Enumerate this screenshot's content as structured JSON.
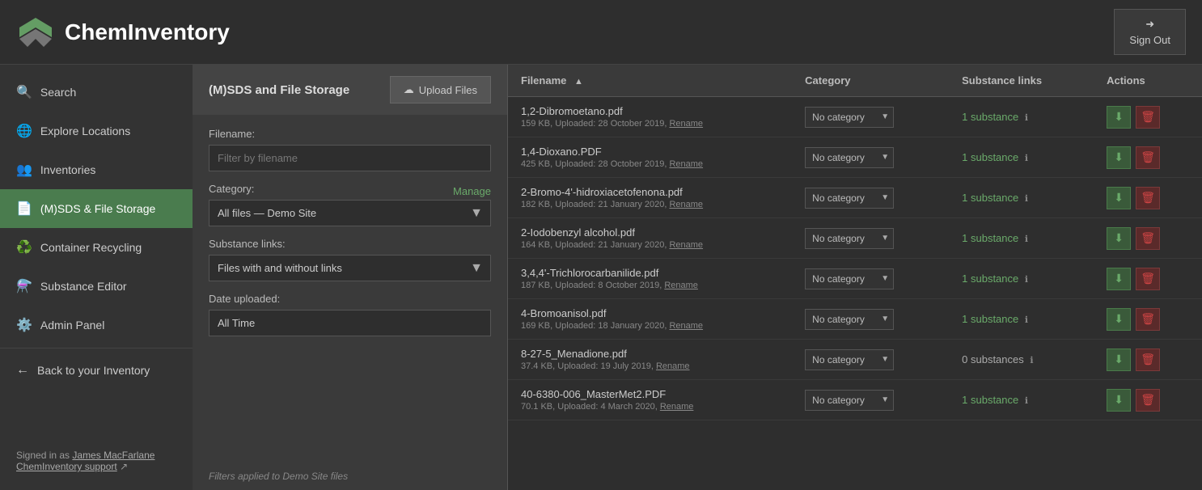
{
  "header": {
    "logo_text": "ChemInventory",
    "sign_out_label": "Sign Out"
  },
  "sidebar": {
    "items": [
      {
        "id": "search",
        "label": "Search",
        "icon": "🔍",
        "active": false
      },
      {
        "id": "explore-locations",
        "label": "Explore Locations",
        "icon": "🌐",
        "active": false
      },
      {
        "id": "inventories",
        "label": "Inventories",
        "icon": "👥",
        "active": false
      },
      {
        "id": "msds-file-storage",
        "label": "(M)SDS & File Storage",
        "icon": "📄",
        "active": true
      },
      {
        "id": "container-recycling",
        "label": "Container Recycling",
        "icon": "♻️",
        "active": false
      },
      {
        "id": "substance-editor",
        "label": "Substance Editor",
        "icon": "⚗️",
        "active": false
      },
      {
        "id": "admin-panel",
        "label": "Admin Panel",
        "icon": "⚙️",
        "active": false
      },
      {
        "id": "back-to-inventory",
        "label": "Back to your Inventory",
        "icon": "←",
        "active": false
      }
    ],
    "signed_in_as": "Signed in as",
    "user_name": "James MacFarlane",
    "support_link": "ChemInventory support"
  },
  "filter_panel": {
    "title": "(M)SDS and File Storage",
    "upload_button": "Upload Files",
    "filename_label": "Filename:",
    "filename_placeholder": "Filter by filename",
    "category_label": "Category:",
    "manage_label": "Manage",
    "category_value": "All files — Demo Site",
    "substance_links_label": "Substance links:",
    "substance_links_value": "Files with and without links",
    "date_uploaded_label": "Date uploaded:",
    "date_uploaded_value": "All Time",
    "footer_note": "Filters applied to Demo Site files"
  },
  "table": {
    "columns": [
      {
        "id": "filename",
        "label": "Filename",
        "sortable": true
      },
      {
        "id": "category",
        "label": "Category",
        "sortable": false
      },
      {
        "id": "substance-links",
        "label": "Substance links",
        "sortable": false
      },
      {
        "id": "actions",
        "label": "Actions",
        "sortable": false
      }
    ],
    "rows": [
      {
        "filename": "1,2-Dibromoetano.pdf",
        "meta": "159 KB, Uploaded: 28 October 2019,",
        "rename": "Rename",
        "category": "No category",
        "substance_count": 1,
        "substance_label": "1 substance",
        "zero": false
      },
      {
        "filename": "1,4-Dioxano.PDF",
        "meta": "425 KB, Uploaded: 28 October 2019,",
        "rename": "Rename",
        "category": "No category",
        "substance_count": 1,
        "substance_label": "1 substance",
        "zero": false
      },
      {
        "filename": "2-Bromo-4'-hidroxiacetofenona.pdf",
        "meta": "182 KB, Uploaded: 21 January 2020,",
        "rename": "Rename",
        "category": "No category",
        "substance_count": 1,
        "substance_label": "1 substance",
        "zero": false
      },
      {
        "filename": "2-Iodobenzyl alcohol.pdf",
        "meta": "164 KB, Uploaded: 21 January 2020,",
        "rename": "Rename",
        "category": "No category",
        "substance_count": 1,
        "substance_label": "1 substance",
        "zero": false
      },
      {
        "filename": "3,4,4'-Trichlorocarbanilide.pdf",
        "meta": "187 KB, Uploaded: 8 October 2019,",
        "rename": "Rename",
        "category": "No category",
        "substance_count": 1,
        "substance_label": "1 substance",
        "zero": false
      },
      {
        "filename": "4-Bromoanisol.pdf",
        "meta": "169 KB, Uploaded: 18 January 2020,",
        "rename": "Rename",
        "category": "No category",
        "substance_count": 1,
        "substance_label": "1 substance",
        "zero": false
      },
      {
        "filename": "8-27-5_Menadione.pdf",
        "meta": "37.4 KB, Uploaded: 19 July 2019,",
        "rename": "Rename",
        "category": "No category",
        "substance_count": 0,
        "substance_label": "0 substances",
        "zero": true
      },
      {
        "filename": "40-6380-006_MasterMet2.PDF",
        "meta": "70.1 KB, Uploaded: 4 March 2020,",
        "rename": "Rename",
        "category": "No category",
        "substance_count": 1,
        "substance_label": "1 substance",
        "zero": false
      }
    ]
  }
}
